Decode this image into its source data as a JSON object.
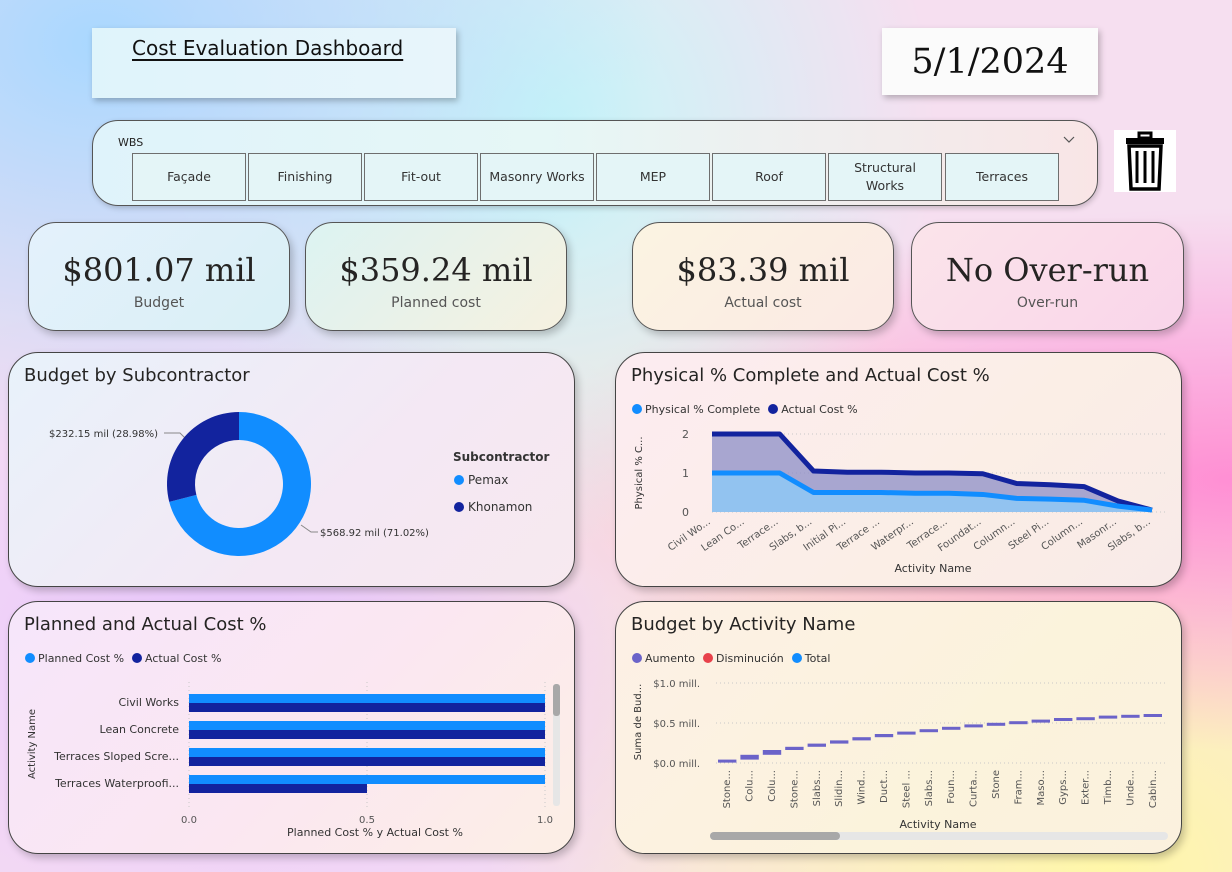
{
  "header": {
    "title": "Cost Evaluation Dashboard",
    "date": "5/1/2024"
  },
  "slicer": {
    "label": "WBS",
    "items": [
      "Façade",
      "Finishing",
      "Fit-out",
      "Masonry Works",
      "MEP",
      "Roof",
      "Structural\nWorks",
      "Terraces"
    ]
  },
  "kpis": [
    {
      "value": "$801.07 mil",
      "label": "Budget"
    },
    {
      "value": "$359.24 mil",
      "label": "Planned cost"
    },
    {
      "value": "$83.39 mil",
      "label": "Actual cost"
    },
    {
      "value": "No Over-run",
      "label": "Over-run"
    }
  ],
  "colors": {
    "light_blue": "#118DFF",
    "dark_blue": "#12239E",
    "red": "#E8414A",
    "purple_blue": "#6B63C9"
  },
  "chart_data": [
    {
      "type": "pie",
      "title": "Budget by Subcontractor",
      "legend_title": "Subcontractor",
      "legend_position": "right",
      "categories": [
        "Pemax",
        "Khonamon"
      ],
      "values": [
        568.92,
        232.15
      ],
      "data_labels": [
        "$568.92 mil (71.02%)",
        "$232.15 mil (28.98%)"
      ]
    },
    {
      "type": "area",
      "title": "Physical % Complete and Actual Cost %",
      "xlabel": "Activity Name",
      "ylabel": "Physical % C...",
      "ylim": [
        0,
        2
      ],
      "yticks": [
        "0",
        "1",
        "2"
      ],
      "categories": [
        "Civil Wo...",
        "Lean Co...",
        "Terrace...",
        "Slabs, b...",
        "Initial Pi...",
        "Terrace ...",
        "Waterpr...",
        "Terrace...",
        "Foundat...",
        "Column...",
        "Steel Pi...",
        "Column...",
        "Masonr...",
        "Slabs, b..."
      ],
      "legend_position": "top-left",
      "series": [
        {
          "name": "Physical % Complete",
          "values": [
            1,
            1,
            1,
            0.5,
            0.5,
            0.5,
            0.48,
            0.48,
            0.45,
            0.35,
            0.33,
            0.3,
            0.15,
            0.05
          ]
        },
        {
          "name": "Actual Cost %",
          "values": [
            2,
            2,
            2,
            1.05,
            1.02,
            1.02,
            1.0,
            1.0,
            0.98,
            0.73,
            0.7,
            0.65,
            0.28,
            0.05
          ]
        }
      ]
    },
    {
      "type": "bar",
      "orientation": "horizontal",
      "title": "Planned and Actual Cost %",
      "xlabel": "Planned Cost % y Actual Cost %",
      "ylabel": "Activity Name",
      "xlim": [
        0,
        1
      ],
      "xticks": [
        "0.0",
        "0.5",
        "1.0"
      ],
      "categories": [
        "Civil Works",
        "Lean Concrete",
        "Terraces Sloped Scre...",
        "Terraces Waterproofi..."
      ],
      "legend_position": "top-left",
      "series": [
        {
          "name": "Planned Cost %",
          "values": [
            1,
            1,
            1,
            1
          ]
        },
        {
          "name": "Actual Cost %",
          "values": [
            1,
            1,
            1,
            0.5
          ]
        }
      ]
    },
    {
      "type": "waterfall",
      "title": "Budget by Activity Name",
      "xlabel": "Activity Name",
      "ylabel": "Suma de Bud...",
      "yticks": [
        "$0.0 mill.",
        "$0.5 mill.",
        "$1.0 mill."
      ],
      "ylim": [
        0,
        1
      ],
      "legend": [
        "Aumento",
        "Disminución",
        "Total"
      ],
      "legend_position": "top-left",
      "categories": [
        "Stone...",
        "Colu...",
        "Colu...",
        "Stone...",
        "Slabs...",
        "Slidin...",
        "Wind...",
        "Duct...",
        "Steel ...",
        "Slabs...",
        "Foun...",
        "Curta...",
        "Stone",
        "Fram...",
        "Maso...",
        "Gyps...",
        "Exter...",
        "Timb...",
        "Unde...",
        "Cabin..."
      ],
      "cumulative": [
        0.03,
        0.09,
        0.15,
        0.19,
        0.23,
        0.27,
        0.31,
        0.35,
        0.38,
        0.41,
        0.44,
        0.47,
        0.49,
        0.51,
        0.53,
        0.55,
        0.56,
        0.58,
        0.59,
        0.6
      ]
    }
  ]
}
